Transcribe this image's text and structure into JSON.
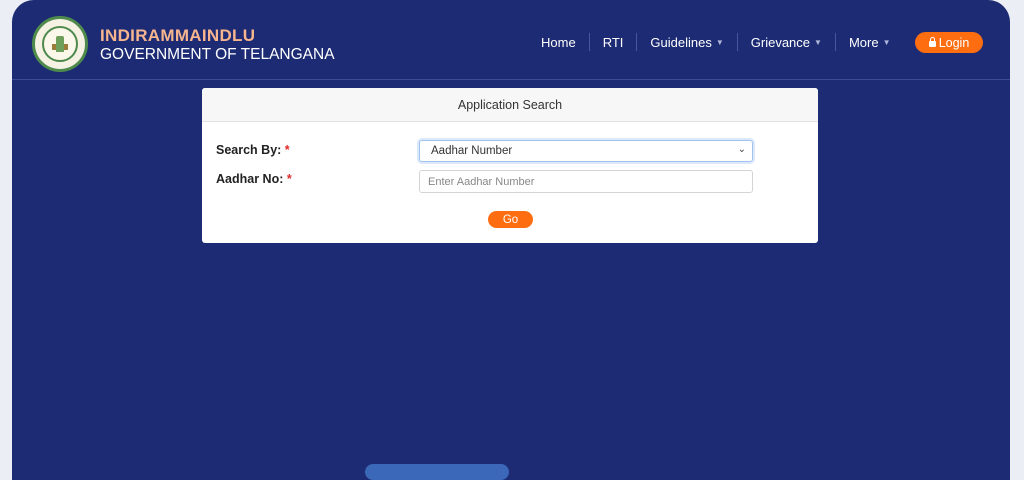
{
  "brand": {
    "title": "INDIRAMMAINDLU",
    "subtitle": "GOVERNMENT OF TELANGANA",
    "logo_icon": "telangana-emblem"
  },
  "nav": {
    "items": [
      {
        "label": "Home",
        "has_dropdown": false
      },
      {
        "label": "RTI",
        "has_dropdown": false
      },
      {
        "label": "Guidelines",
        "has_dropdown": true
      },
      {
        "label": "Grievance",
        "has_dropdown": true
      },
      {
        "label": "More",
        "has_dropdown": true
      }
    ],
    "login_label": "Login"
  },
  "search_card": {
    "title": "Application Search",
    "search_by_label": "Search By:",
    "aadhar_label": "Aadhar No:",
    "required_mark": "*",
    "search_by_value": "Aadhar Number",
    "aadhar_placeholder": "Enter Aadhar Number",
    "go_label": "Go"
  },
  "colors": {
    "background": "#1c2b73",
    "accent": "#ff6d11",
    "brand_title": "#f7b58f"
  }
}
